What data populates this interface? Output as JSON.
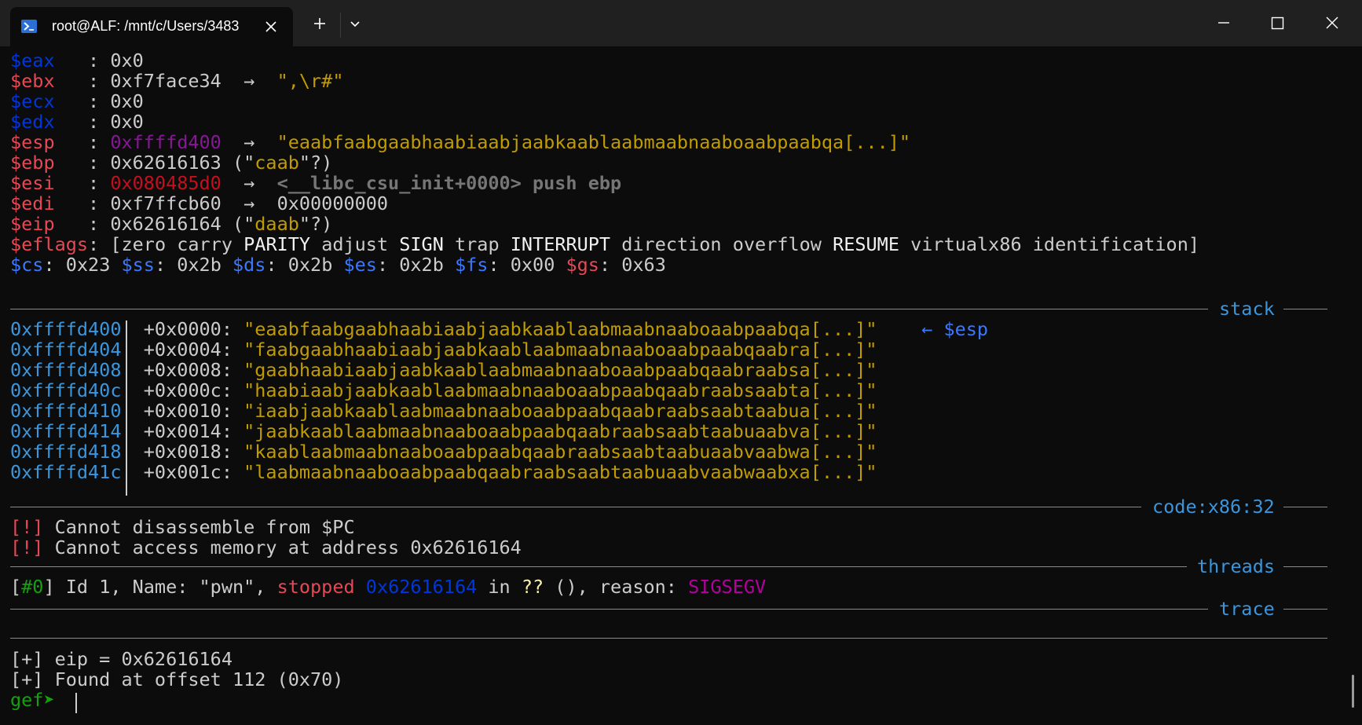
{
  "tab": {
    "title": "root@ALF: /mnt/c/Users/3483"
  },
  "registers": [
    {
      "name": "$eax",
      "pad": "   ",
      "sep": ": ",
      "value": "0x0"
    },
    {
      "name": "$ebx",
      "pad": "   ",
      "sep": ": ",
      "value": "0xf7face34",
      "arrow": "  →  ",
      "deref": "\",\\r#\""
    },
    {
      "name": "$ecx",
      "pad": "   ",
      "sep": ": ",
      "value": "0x0"
    },
    {
      "name": "$edx",
      "pad": "   ",
      "sep": ": ",
      "value": "0x0"
    },
    {
      "name": "$esp",
      "pad": "   ",
      "sep": ": ",
      "value": "0xffffd400",
      "arrow": "  →  ",
      "deref": "\"eaabfaabgaabhaabiaabjaabkaablaabmaabnaaboaabpaabqa[...]\""
    },
    {
      "name": "$ebp",
      "pad": "   ",
      "sep": ": ",
      "value": "0x62616163 (\"",
      "str": "caab",
      "tail": "\"?)"
    },
    {
      "name": "$esi",
      "pad": "   ",
      "sep": ": ",
      "value": "0x080485d0",
      "arrow": "  →  ",
      "deref": "<__libc_csu_init+0000> push ebp"
    },
    {
      "name": "$edi",
      "pad": "   ",
      "sep": ": ",
      "value": "0xf7ffcb60",
      "arrow": "  →  ",
      "deref": "0x00000000"
    },
    {
      "name": "$eip",
      "pad": "   ",
      "sep": ": ",
      "value": "0x62616164 (\"",
      "str": "daab",
      "tail": "\"?)"
    }
  ],
  "eflags": {
    "name": "$eflags",
    "sep": ": [",
    "flags": [
      "zero",
      "carry",
      "PARITY",
      "adjust",
      "SIGN",
      "trap",
      "INTERRUPT",
      "direction",
      "overflow",
      "RESUME",
      "virtualx86",
      "identification"
    ],
    "end": "]"
  },
  "segments": [
    {
      "name": "$cs",
      "value": ": 0x23 "
    },
    {
      "name": "$ss",
      "value": ": 0x2b "
    },
    {
      "name": "$ds",
      "value": ": 0x2b "
    },
    {
      "name": "$es",
      "value": ": 0x2b "
    },
    {
      "name": "$fs",
      "value": ": 0x00 "
    },
    {
      "name": "$gs",
      "value": ": 0x63"
    }
  ],
  "sections": {
    "stack": "stack",
    "code": "code:x86:32",
    "threads": "threads",
    "trace": "trace"
  },
  "stack": [
    {
      "addr": "0xffffd400",
      "off": "+0x0000: ",
      "val": "\"eaabfaabgaabhaabiaabjaabkaablaabmaabnaaboaabpaabqa[...]\"",
      "note": "← $esp"
    },
    {
      "addr": "0xffffd404",
      "off": "+0x0004: ",
      "val": "\"faabgaabhaabiaabjaabkaablaabmaabnaaboaabpaabqaabra[...]\""
    },
    {
      "addr": "0xffffd408",
      "off": "+0x0008: ",
      "val": "\"gaabhaabiaabjaabkaablaabmaabnaaboaabpaabqaabraabsa[...]\""
    },
    {
      "addr": "0xffffd40c",
      "off": "+0x000c: ",
      "val": "\"haabiaabjaabkaablaabmaabnaaboaabpaabqaabraabsaabta[...]\""
    },
    {
      "addr": "0xffffd410",
      "off": "+0x0010: ",
      "val": "\"iaabjaabkaablaabmaabnaaboaabpaabqaabraabsaabtaabua[...]\""
    },
    {
      "addr": "0xffffd414",
      "off": "+0x0014: ",
      "val": "\"jaabkaablaabmaabnaaboaabpaabqaabraabsaabtaabuaabva[...]\""
    },
    {
      "addr": "0xffffd418",
      "off": "+0x0018: ",
      "val": "\"kaablaabmaabnaaboaabpaabqaabraabsaabtaabuaabvaabwa[...]\""
    },
    {
      "addr": "0xffffd41c",
      "off": "+0x001c: ",
      "val": "\"laabmaabnaaboaabpaabqaabraabsaabtaabuaabvaabwaabxa[...]\""
    }
  ],
  "code": [
    {
      "tag": "[!]",
      "msg": " Cannot disassemble from $PC"
    },
    {
      "tag": "[!]",
      "msg": " Cannot access memory at address 0x62616164"
    }
  ],
  "threads": {
    "open": "[",
    "id": "#0",
    "close": "] ",
    "info": "Id 1, Name: \"pwn\", ",
    "state": "stopped",
    "addr": "0x62616164",
    "in": " in ",
    "fn": "??",
    "mid": " (), reason: ",
    "reason": "SIGSEGV"
  },
  "output": [
    "[+] eip = 0x62616164",
    "[+] Found at offset 112 (0x70)"
  ],
  "prompt": "gef➤ "
}
